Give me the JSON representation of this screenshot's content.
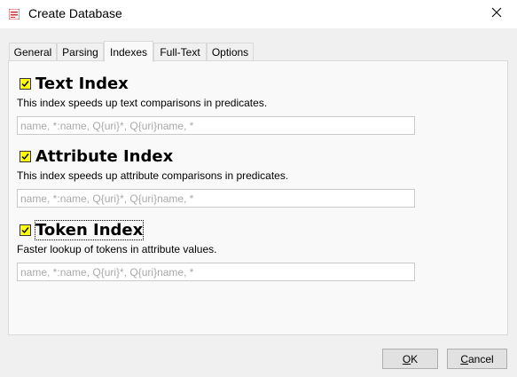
{
  "window": {
    "title": "Create Database",
    "app_icon": "basex-icon",
    "close_icon": "close-icon"
  },
  "tabs": [
    {
      "label": "General",
      "active": false
    },
    {
      "label": "Parsing",
      "active": false
    },
    {
      "label": "Indexes",
      "active": true
    },
    {
      "label": "Full-Text",
      "active": false
    },
    {
      "label": "Options",
      "active": false
    }
  ],
  "sections": {
    "text": {
      "title": "Text Index",
      "checked": true,
      "description": "This index speeds up text comparisons in predicates.",
      "placeholder": "name, *:name, Q{uri}*, Q{uri}name, *",
      "value": ""
    },
    "attribute": {
      "title": "Attribute Index",
      "checked": true,
      "description": "This index speeds up attribute comparisons in predicates.",
      "placeholder": "name, *:name, Q{uri}*, Q{uri}name, *",
      "value": ""
    },
    "token": {
      "title": "Token Index",
      "checked": true,
      "description": "Faster lookup of tokens in attribute values.",
      "placeholder": "name, *:name, Q{uri}*, Q{uri}name, *",
      "value": ""
    }
  },
  "buttons": {
    "ok": {
      "mnemonic": "O",
      "rest": "K"
    },
    "cancel": {
      "mnemonic": "C",
      "rest": "ancel"
    }
  },
  "colors": {
    "highlight": "#ffff00",
    "panel_bg": "#f9f9f9",
    "window_bg": "#f0f0f0"
  }
}
